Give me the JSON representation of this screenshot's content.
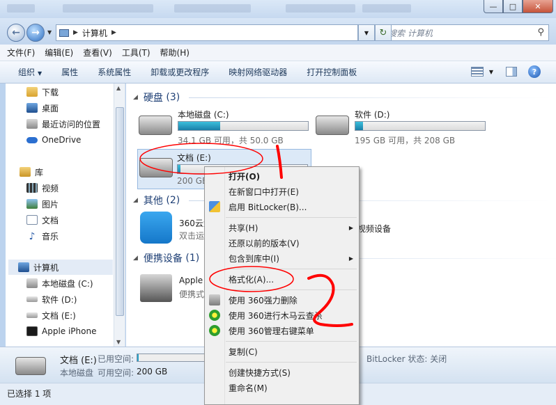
{
  "window": {
    "controls": {
      "minimize": "—",
      "maximize": "□",
      "close": "✕"
    }
  },
  "nav": {
    "back": "←",
    "forward": "→",
    "address": {
      "path": [
        "计算机"
      ]
    },
    "refresh": "↻",
    "search_placeholder": "搜索 计算机"
  },
  "menubar": [
    "文件(F)",
    "编辑(E)",
    "查看(V)",
    "工具(T)",
    "帮助(H)"
  ],
  "cmdbar": [
    "组织",
    "属性",
    "系统属性",
    "卸载或更改程序",
    "映射网络驱动器",
    "打开控制面板"
  ],
  "help": "?",
  "sidebar": {
    "favorites": [
      "下载",
      "桌面",
      "最近访问的位置",
      "OneDrive"
    ],
    "library_title": "库",
    "libraries": [
      "视频",
      "图片",
      "文档",
      "音乐"
    ],
    "computer_title": "计算机",
    "computer_items": [
      "本地磁盘 (C:)",
      "软件 (D:)",
      "文档 (E:)",
      "Apple iPhone"
    ]
  },
  "content": {
    "groups": [
      {
        "title": "硬盘",
        "count": "(3)"
      },
      {
        "title": "其他",
        "count": "(2)"
      },
      {
        "title": "便携设备",
        "count": "(1)"
      }
    ],
    "drives": [
      {
        "name": "本地磁盘 (C:)",
        "info": "34.1 GB 可用，共 50.0 GB",
        "used_fraction": 0.32
      },
      {
        "name": "软件 (D:)",
        "info": "195 GB 可用，共 208 GB",
        "used_fraction": 0.06
      },
      {
        "name": "文档 (E:)",
        "info": "200 GB",
        "used_fraction": 0.02
      }
    ],
    "others": [
      {
        "name": "360云盘",
        "sub": "双击运行360云盘"
      },
      {
        "name": "视频设备"
      }
    ],
    "portable": {
      "name": "Apple",
      "sub": "便携式设"
    }
  },
  "details": {
    "drive_name": "文档 (E:)",
    "used_label": "已用空间:",
    "type": "本地磁盘",
    "free_label": "可用空间:",
    "free_value": "200 GB",
    "bitlocker": "BitLocker 状态: 关闭"
  },
  "status": {
    "text": "已选择 1 项"
  },
  "context_menu": {
    "items": [
      "打开(O)",
      "在新窗口中打开(E)",
      "启用 BitLocker(B)...",
      "共享(H)",
      "还原以前的版本(V)",
      "包含到库中(I)",
      "格式化(A)...",
      "使用 360强力删除",
      "使用 360进行木马云查杀",
      "使用 360管理右键菜单",
      "复制(C)",
      "创建快捷方式(S)",
      "重命名(M)"
    ],
    "annotations": [
      "1",
      "2"
    ]
  },
  "colors": {
    "disk_fill": "#26a0c8",
    "annotation": "#ff0000"
  }
}
